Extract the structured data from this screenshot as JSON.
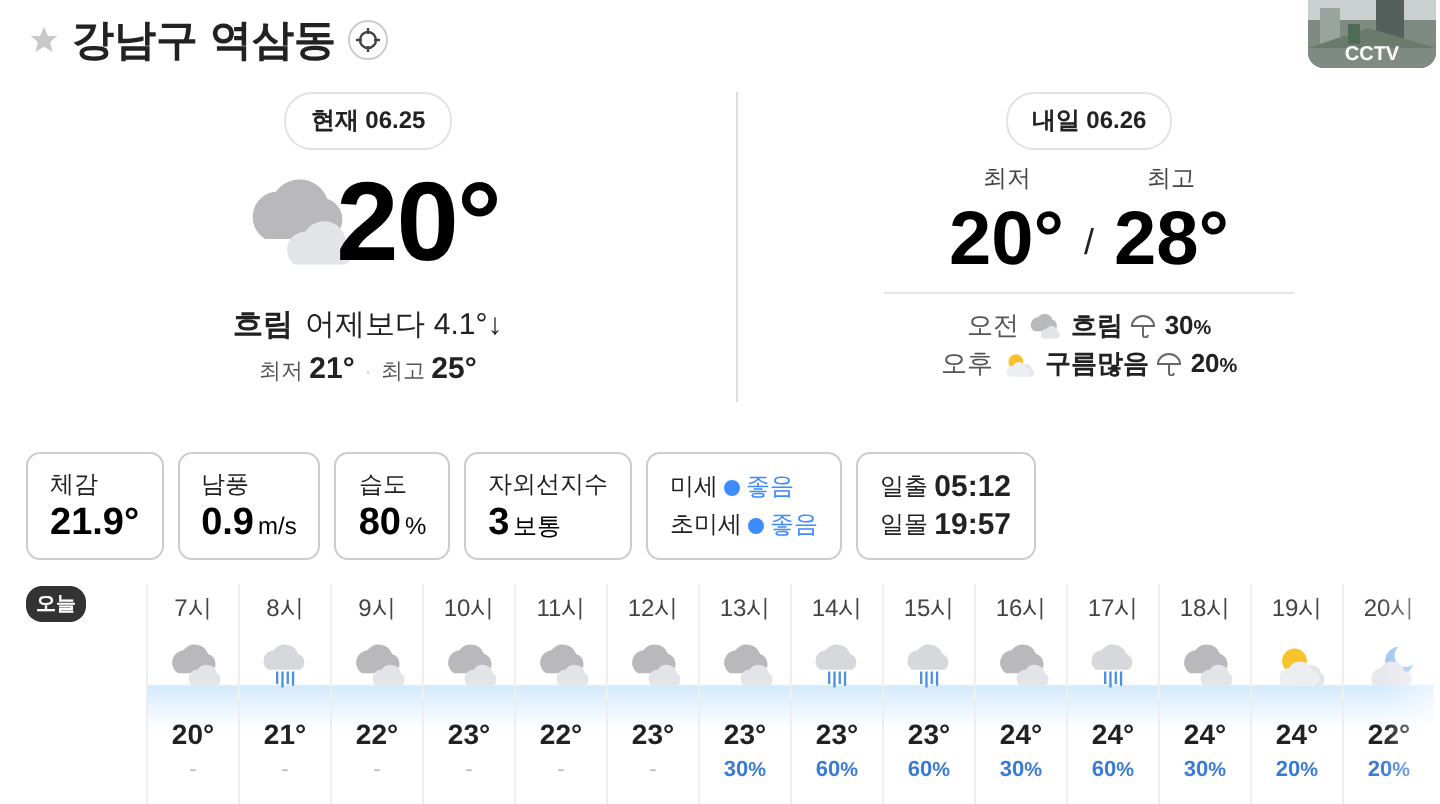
{
  "header": {
    "title": "강남구 역삼동",
    "favorite": false,
    "cctv_label": "CCTV"
  },
  "today": {
    "badge": "현재 06.25",
    "kind": "cloudy",
    "temp": "20°",
    "condition": "흐림",
    "compare": "어제보다 4.1°↓",
    "low_label": "최저",
    "low": "21°",
    "separator": "·",
    "high_label": "최고",
    "high": "25°"
  },
  "tomorrow": {
    "badge": "내일 06.26",
    "low_label": "최저",
    "low": "20°",
    "separator": "/",
    "high_label": "최고",
    "high": "28°",
    "periods": [
      {
        "label": "오전",
        "kind": "cloudy",
        "condition": "흐림",
        "precip": "30",
        "unit": "%"
      },
      {
        "label": "오후",
        "kind": "partly_cloudy",
        "condition": "구름많음",
        "precip": "20",
        "unit": "%"
      }
    ]
  },
  "cards": [
    {
      "kind": "value",
      "label": "체감",
      "value": "21.9°"
    },
    {
      "kind": "value",
      "label": "남풍",
      "value": "0.9",
      "unit": "m/s"
    },
    {
      "kind": "value",
      "label": "습도",
      "value": "80",
      "unit": "%"
    },
    {
      "kind": "value",
      "label": "자외선지수",
      "value": "3",
      "unit": "보통"
    },
    {
      "kind": "rows",
      "rows": [
        {
          "label": "미세",
          "value": "좋음",
          "color": "#3d8bff"
        },
        {
          "label": "초미세",
          "value": "좋음",
          "color": "#3d8bff"
        }
      ]
    },
    {
      "kind": "rows",
      "rows": [
        {
          "label": "일출",
          "value": "05:12"
        },
        {
          "label": "일몰",
          "value": "19:57"
        }
      ]
    }
  ],
  "hourly": {
    "day_label": "오늘",
    "hours": [
      {
        "time": "7시",
        "kind": "cloudy",
        "temp": "20°",
        "precip": "-"
      },
      {
        "time": "8시",
        "kind": "rain",
        "temp": "21°",
        "precip": "-"
      },
      {
        "time": "9시",
        "kind": "cloudy",
        "temp": "22°",
        "precip": "-"
      },
      {
        "time": "10시",
        "kind": "cloudy",
        "temp": "23°",
        "precip": "-"
      },
      {
        "time": "11시",
        "kind": "cloudy",
        "temp": "22°",
        "precip": "-"
      },
      {
        "time": "12시",
        "kind": "cloudy",
        "temp": "23°",
        "precip": "-"
      },
      {
        "time": "13시",
        "kind": "cloudy",
        "temp": "23°",
        "precip": "30",
        "unit": "%"
      },
      {
        "time": "14시",
        "kind": "rain",
        "temp": "23°",
        "precip": "60",
        "unit": "%"
      },
      {
        "time": "15시",
        "kind": "rain",
        "temp": "23°",
        "precip": "60",
        "unit": "%"
      },
      {
        "time": "16시",
        "kind": "cloudy",
        "temp": "24°",
        "precip": "30",
        "unit": "%"
      },
      {
        "time": "17시",
        "kind": "rain",
        "temp": "24°",
        "precip": "60",
        "unit": "%"
      },
      {
        "time": "18시",
        "kind": "cloudy",
        "temp": "24°",
        "precip": "30",
        "unit": "%"
      },
      {
        "time": "19시",
        "kind": "partly_cloudy",
        "temp": "24°",
        "precip": "20",
        "unit": "%"
      },
      {
        "time": "20시",
        "kind": "night_cloudy",
        "temp": "22°",
        "precip": "20",
        "unit": "%"
      }
    ]
  }
}
